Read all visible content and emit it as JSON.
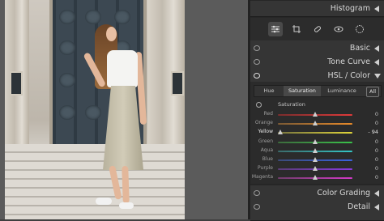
{
  "panels": {
    "histogram": {
      "title": "Histogram"
    },
    "basic": {
      "title": "Basic"
    },
    "tone_curve": {
      "title": "Tone Curve"
    },
    "hsl": {
      "title": "HSL / Color"
    },
    "color_grading": {
      "title": "Color Grading"
    },
    "detail": {
      "title": "Detail"
    }
  },
  "toolbar": {
    "tools": [
      {
        "name": "edit-sliders-icon",
        "glyph": "☰"
      },
      {
        "name": "crop-icon",
        "glyph": "⌗"
      },
      {
        "name": "healing-icon",
        "glyph": "✎"
      },
      {
        "name": "red-eye-icon",
        "glyph": "◉"
      },
      {
        "name": "masking-icon",
        "glyph": "◍"
      }
    ]
  },
  "hsl": {
    "tabs": {
      "hue": "Hue",
      "saturation": "Saturation",
      "luminance": "Luminance",
      "all": "All"
    },
    "active_tab": "Saturation",
    "section_title": "Saturation",
    "sliders": [
      {
        "label": "Red",
        "value": "0",
        "fraction": 0.5,
        "colors": [
          "#7a2d2d",
          "#e03a3a"
        ]
      },
      {
        "label": "Orange",
        "value": "0",
        "fraction": 0.5,
        "colors": [
          "#7a5a35",
          "#e88a2a"
        ]
      },
      {
        "label": "Yellow",
        "value": "- 94",
        "fraction": 0.03,
        "colors": [
          "#76733f",
          "#e0d53a"
        ]
      },
      {
        "label": "Green",
        "value": "0",
        "fraction": 0.5,
        "colors": [
          "#3d6b3d",
          "#3ac24a"
        ]
      },
      {
        "label": "Aqua",
        "value": "0",
        "fraction": 0.5,
        "colors": [
          "#3b6a6a",
          "#34c6c6"
        ]
      },
      {
        "label": "Blue",
        "value": "0",
        "fraction": 0.5,
        "colors": [
          "#3b4a78",
          "#3a62e0"
        ]
      },
      {
        "label": "Purple",
        "value": "0",
        "fraction": 0.5,
        "colors": [
          "#5a3d78",
          "#8a3ae0"
        ]
      },
      {
        "label": "Magenta",
        "value": "0",
        "fraction": 0.5,
        "colors": [
          "#703d6a",
          "#d43ac8"
        ]
      }
    ]
  }
}
